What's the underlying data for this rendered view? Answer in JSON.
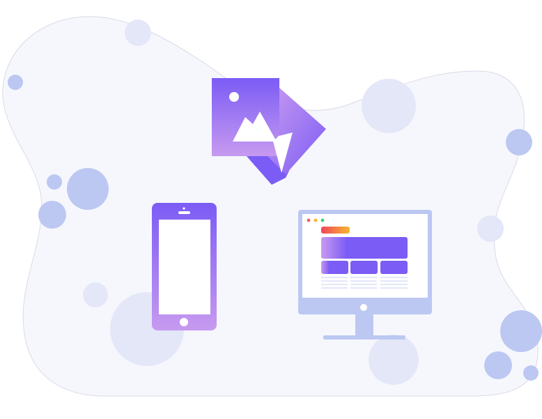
{
  "illustration": {
    "background_color": "#f6f7fd",
    "outline_color": "#d8dae6",
    "bubble_light": "#e3e7f8",
    "bubble_mid": "#bcc8f2",
    "accent_purple": "#7b5cf5",
    "accent_lilac": "#c79af0",
    "monitor_frame": "#bcc8f2",
    "traffic_lights": [
      "#f25f5c",
      "#f7b731",
      "#3ecf6f"
    ],
    "browser_bar_gradient": [
      "#f2445a",
      "#f7b731"
    ],
    "icons": [
      "image-icon",
      "smartphone-icon",
      "desktop-monitor-icon"
    ]
  }
}
